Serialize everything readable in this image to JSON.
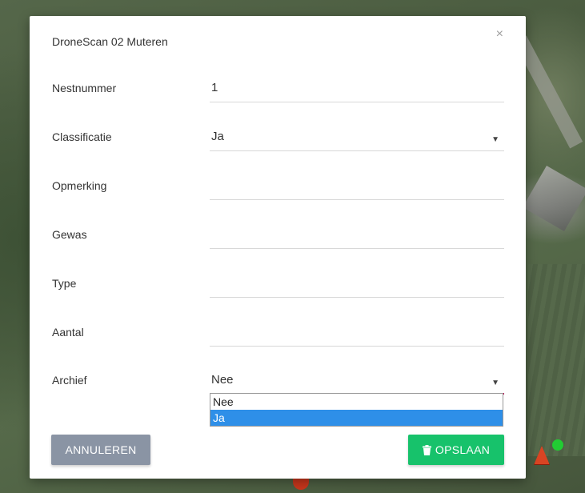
{
  "modal": {
    "title": "DroneScan 02 Muteren",
    "close_symbol": "×"
  },
  "form": {
    "fields": [
      {
        "label": "Nestnummer",
        "value": "1"
      },
      {
        "label": "Classificatie",
        "value": "Ja",
        "caret": "▼"
      },
      {
        "label": "Opmerking",
        "value": ""
      },
      {
        "label": "Gewas",
        "value": ""
      },
      {
        "label": "Type",
        "value": ""
      },
      {
        "label": "Aantal",
        "value": ""
      },
      {
        "label": "Archief",
        "value": "Nee",
        "caret": "▼"
      }
    ],
    "archief_options": [
      "Nee",
      "Ja"
    ],
    "archief_highlighted": "Ja"
  },
  "actions": {
    "cancel_label": "ANNULEREN",
    "save_label": "OPSLAAN",
    "save_icon": "trash-icon"
  },
  "colors": {
    "cancel": "#8a94a4",
    "save": "#17c26b",
    "active_underline": "#c2185b",
    "option_highlight": "#2e8fe8"
  }
}
